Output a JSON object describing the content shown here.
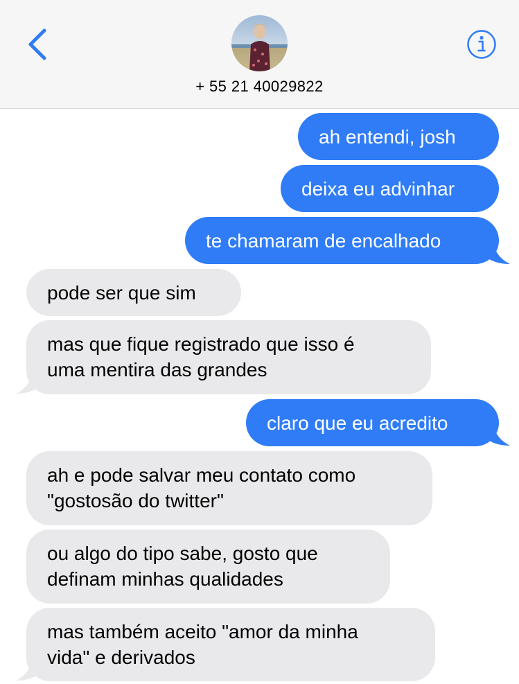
{
  "header": {
    "phone": "+ 55 21 40029822",
    "back_icon": "chevron-left-icon",
    "info_icon": "info-circle-icon",
    "accent": "#2f7cf6"
  },
  "colors": {
    "outgoing_bubble": "#2f7cf6",
    "incoming_bubble": "#e9e9eb"
  },
  "messages": [
    {
      "direction": "out",
      "lines": [
        "ah entendi, josh"
      ]
    },
    {
      "direction": "out",
      "lines": [
        "deixa eu advinhar"
      ]
    },
    {
      "direction": "out",
      "lines": [
        "te chamaram de encalhado"
      ]
    },
    {
      "direction": "in",
      "lines": [
        "pode ser que sim"
      ]
    },
    {
      "direction": "in",
      "lines": [
        "mas que fique registrado que isso é",
        "uma mentira das grandes"
      ]
    },
    {
      "direction": "out",
      "lines": [
        "claro que eu acredito"
      ]
    },
    {
      "direction": "in",
      "lines": [
        "ah e pode salvar meu contato como",
        "\"gostosão do twitter\""
      ]
    },
    {
      "direction": "in",
      "lines": [
        "ou algo do tipo sabe, gosto que",
        "definam minhas qualidades"
      ]
    },
    {
      "direction": "in",
      "lines": [
        "mas também aceito \"amor da minha",
        "vida\" e derivados"
      ]
    }
  ]
}
